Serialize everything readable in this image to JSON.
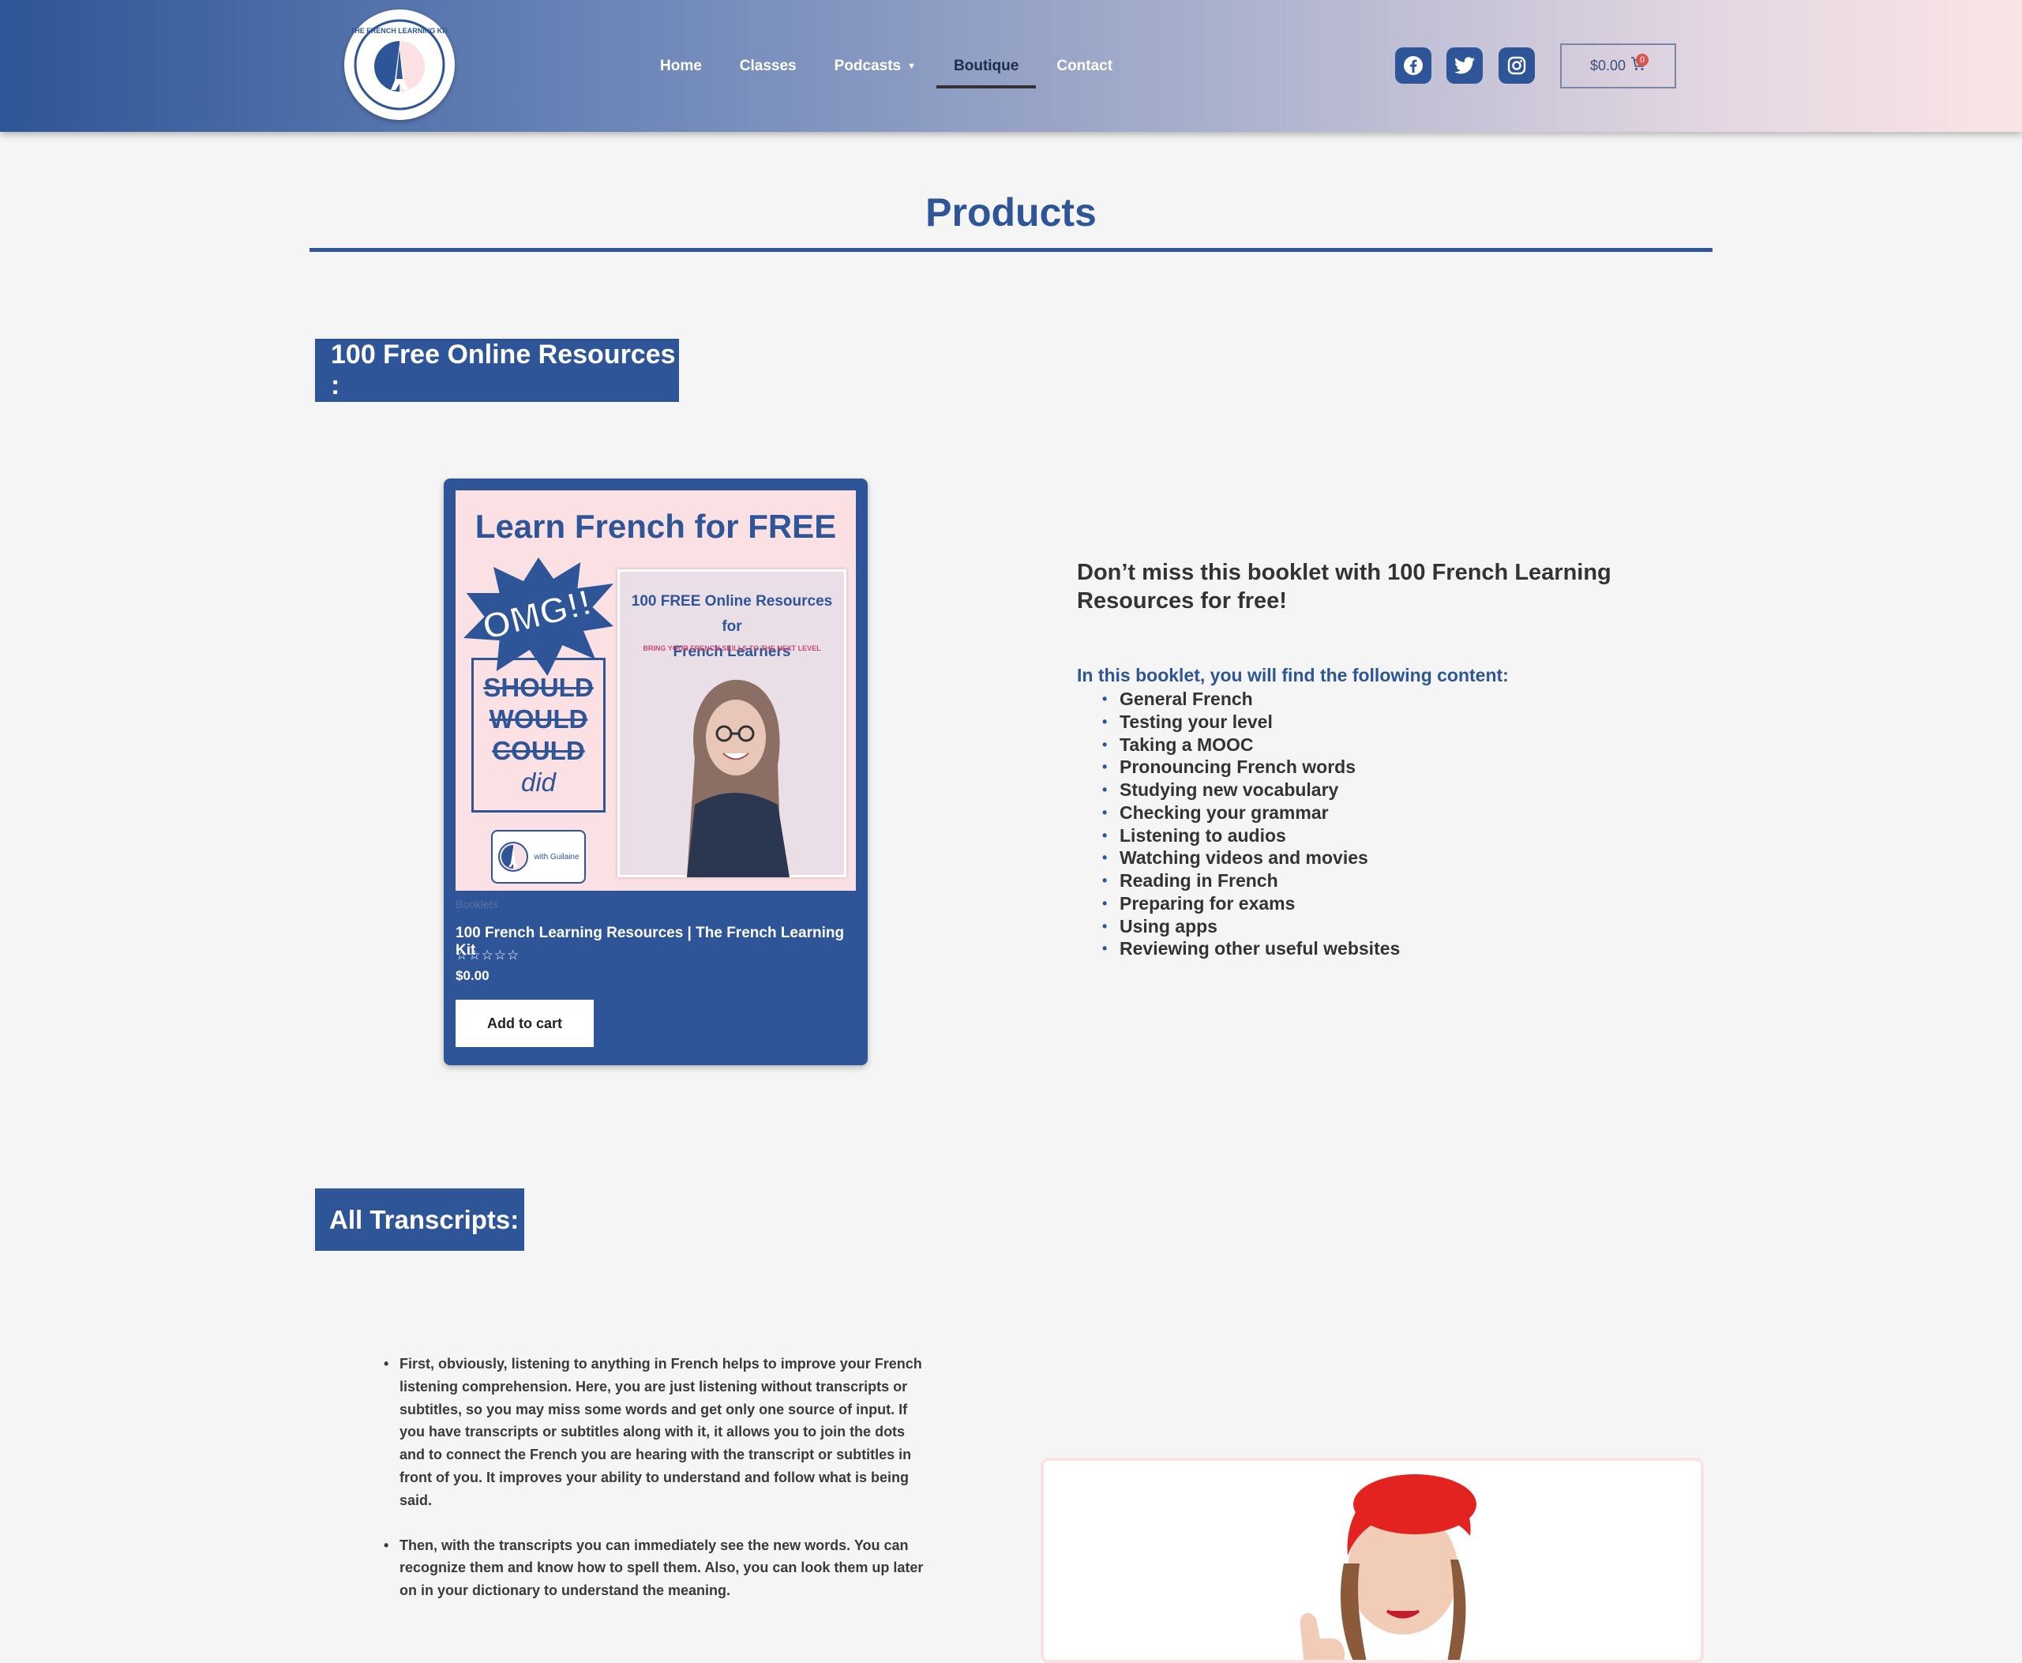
{
  "header": {
    "logo_text": "THE FRENCH LEARNING KIT",
    "nav": [
      {
        "label": "Home"
      },
      {
        "label": "Classes"
      },
      {
        "label": "Podcasts"
      },
      {
        "label": "Boutique"
      },
      {
        "label": "Contact"
      }
    ],
    "active_nav": "Boutique",
    "social": [
      "facebook-icon",
      "twitter-icon",
      "instagram-icon"
    ],
    "cart": {
      "amount": "$0.00",
      "count": "0"
    }
  },
  "page": {
    "title": "Products"
  },
  "free_section": {
    "label": "100 Free Online Resources :"
  },
  "product": {
    "cover": {
      "title": "Learn French for FREE",
      "burst": "OMG!!",
      "words": [
        "SHOULD",
        "WOULD",
        "COULD"
      ],
      "did": "did",
      "booklet_title_1": "100 FREE Online Resources for",
      "booklet_title_2": "French Learners",
      "booklet_sub": "BRING YOUR FRENCH SKILLS TO THE NEXT LEVEL",
      "mini_logo_text": "with Guilaine"
    },
    "category": "Booklets",
    "name": "100 French Learning Resources | The French Learning Kit",
    "rating": "☆☆☆☆☆",
    "price": "$0.00",
    "add_to_cart": "Add to cart"
  },
  "description": {
    "heading": "Don’t miss this booklet with 100 French Learning Resources for free!",
    "intro": "In this booklet, you will find the following content:",
    "items": [
      "General French",
      "Testing your level",
      "Taking a MOOC",
      "Pronouncing French words",
      "Studying new vocabulary",
      "Checking your grammar",
      "Listening to audios",
      "Watching videos and movies",
      "Reading in French",
      "Preparing for exams",
      "Using apps",
      "Reviewing other useful websites"
    ]
  },
  "transcripts_section": {
    "label": "All Transcripts:",
    "points": [
      "First, obviously, listening to anything in French helps to improve your French listening comprehension. Here, you are just listening without transcripts or subtitles, so you may miss some words and get only one source of input. If you have transcripts or subtitles along with it, it allows you to join the dots and to connect the French you are hearing with the transcript or subtitles in front of you. It improves your ability to understand and follow what is being said.",
      "Then, with the transcripts you can immediately see the new words. You can recognize them and know how to spell them. Also, you can look them up later on in your dictionary to understand the meaning."
    ]
  },
  "colors": {
    "brand_blue": "#2e5597",
    "pink": "#fbe0e4",
    "beret_red": "#e3231f"
  }
}
